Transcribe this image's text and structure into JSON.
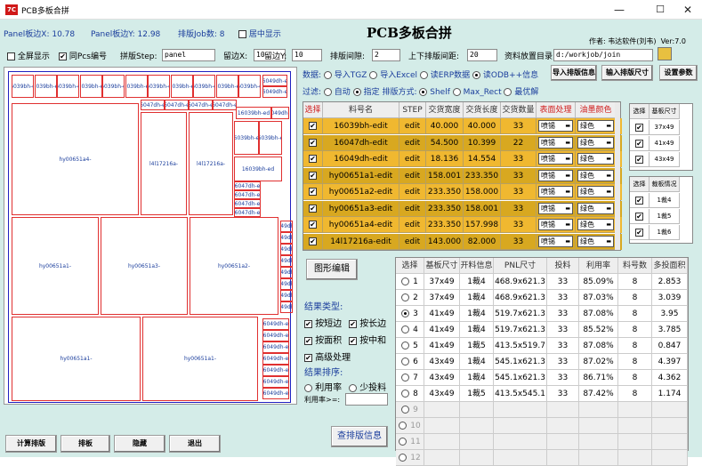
{
  "window": {
    "title": "PCB多板合拼",
    "minimize": "—",
    "maximize": "☐",
    "close": "✕"
  },
  "header": {
    "panel_x_label": "Panel板边X:",
    "panel_x": "10.78",
    "panel_y_label": "Panel板边Y:",
    "panel_y": "12.98",
    "jobs_label": "排版Job数:",
    "jobs": "8",
    "center_label": "居中显示",
    "app_title": "PCB多板合拼",
    "author": "作者: 韦达软件(刘韦)",
    "version": "Ver:7.0"
  },
  "opts": {
    "fullscreen": "全屏显示",
    "same_pcs": "同Pcs编号",
    "step_label": "拼版Step:",
    "step_value": "panel",
    "margin_x_label": "留边X:",
    "margin_x": "10",
    "margin_y_label": "留边Y:",
    "margin_y": "10",
    "gap_label": "排版间隙:",
    "gap": "2",
    "updown_label": "上下排版间距:",
    "updown": "20",
    "dir_label": "资料放置目录:",
    "dir": "d:/workjob/join"
  },
  "data_row": {
    "label": "数据:",
    "opt1": "导入TGZ",
    "opt2": "导入Excel",
    "opt3": "读ERP数据",
    "opt4": "读ODB++信息",
    "btn1": "导入排版信息",
    "btn2": "输入排版尺寸",
    "btn3": "设置参数"
  },
  "filter_row": {
    "label": "过滤:",
    "opt1": "自动",
    "opt2": "指定",
    "mode_label": "排版方式:",
    "mode1": "Shelf",
    "mode2": "Max_Rect",
    "mode3": "最优解"
  },
  "main_grid": {
    "headers": [
      "选择",
      "料号名",
      "STEP",
      "交货宽度",
      "交货长度",
      "交货数量",
      "表面处理",
      "油墨颜色"
    ],
    "rows": [
      {
        "sel": "✔",
        "name": "16039bh-edit",
        "step": "edit",
        "w": "40.000",
        "l": "40.000",
        "q": "33",
        "surface": "喷锡",
        "color": "绿色"
      },
      {
        "sel": "✔",
        "name": "16047dh-edit",
        "step": "edit",
        "w": "54.500",
        "l": "10.399",
        "q": "22",
        "surface": "喷锡",
        "color": "绿色"
      },
      {
        "sel": "✔",
        "name": "16049dh-edit",
        "step": "edit",
        "w": "18.136",
        "l": "14.554",
        "q": "33",
        "surface": "喷锡",
        "color": "绿色"
      },
      {
        "sel": "✔",
        "name": "hy00651a1-edit",
        "step": "edit",
        "w": "158.001",
        "l": "233.350",
        "q": "33",
        "surface": "喷锡",
        "color": "绿色"
      },
      {
        "sel": "✔",
        "name": "hy00651a2-edit",
        "step": "edit",
        "w": "233.350",
        "l": "158.000",
        "q": "33",
        "surface": "喷锡",
        "color": "绿色"
      },
      {
        "sel": "✔",
        "name": "hy00651a3-edit",
        "step": "edit",
        "w": "233.350",
        "l": "158.001",
        "q": "33",
        "surface": "喷锡",
        "color": "绿色"
      },
      {
        "sel": "✔",
        "name": "hy00651a4-edit",
        "step": "edit",
        "w": "233.350",
        "l": "157.998",
        "q": "33",
        "surface": "喷锡",
        "color": "绿色"
      },
      {
        "sel": "✔",
        "name": "14l17216a-edit",
        "step": "edit",
        "w": "143.000",
        "l": "82.000",
        "q": "33",
        "surface": "喷锡",
        "color": "绿色"
      }
    ]
  },
  "side_grid1": {
    "headers": [
      "选择",
      "基板尺寸"
    ],
    "rows": [
      {
        "sel": "✔",
        "v": "37x49"
      },
      {
        "sel": "✔",
        "v": "41x49"
      },
      {
        "sel": "✔",
        "v": "43x49"
      }
    ]
  },
  "side_grid2": {
    "headers": [
      "选择",
      "裁板情况"
    ],
    "rows": [
      {
        "sel": "✔",
        "v": "1裁4"
      },
      {
        "sel": "✔",
        "v": "1裁5"
      },
      {
        "sel": "✔",
        "v": "1裁6"
      }
    ]
  },
  "results": {
    "graph_btn": "图形编辑",
    "type_label": "结果类型:",
    "cb1": "按短边",
    "cb2": "按长边",
    "cb3": "按面积",
    "cb4": "按中和",
    "cb5": "高级处理",
    "sort_label": "结果排序:",
    "sort1": "利用率",
    "sort2": "少投料",
    "util_label": "利用率>=:",
    "query_btn": "查排版信息"
  },
  "result_grid": {
    "headers": [
      "选择",
      "基板尺寸",
      "开料信息",
      "PNL尺寸",
      "投料",
      "利用率",
      "料号数",
      "多投面积"
    ],
    "rows": [
      {
        "n": "1",
        "a": "37x49",
        "b": "1裁4",
        "c": "468.9x621.3",
        "d": "33",
        "e": "85.09%",
        "f": "8",
        "g": "2.853",
        "on": false
      },
      {
        "n": "2",
        "a": "37x49",
        "b": "1裁4",
        "c": "468.9x621.3",
        "d": "33",
        "e": "87.03%",
        "f": "8",
        "g": "3.039",
        "on": false
      },
      {
        "n": "3",
        "a": "41x49",
        "b": "1裁4",
        "c": "519.7x621.3",
        "d": "33",
        "e": "87.08%",
        "f": "8",
        "g": "3.95",
        "on": true
      },
      {
        "n": "4",
        "a": "41x49",
        "b": "1裁4",
        "c": "519.7x621.3",
        "d": "33",
        "e": "85.52%",
        "f": "8",
        "g": "3.785",
        "on": false
      },
      {
        "n": "5",
        "a": "41x49",
        "b": "1裁5",
        "c": "413.5x519.7",
        "d": "33",
        "e": "87.08%",
        "f": "8",
        "g": "0.847",
        "on": false
      },
      {
        "n": "6",
        "a": "43x49",
        "b": "1裁4",
        "c": "545.1x621.3",
        "d": "33",
        "e": "87.02%",
        "f": "8",
        "g": "4.397",
        "on": false
      },
      {
        "n": "7",
        "a": "43x49",
        "b": "1裁4",
        "c": "545.1x621.3",
        "d": "33",
        "e": "86.71%",
        "f": "8",
        "g": "4.362",
        "on": false
      },
      {
        "n": "8",
        "a": "43x49",
        "b": "1裁5",
        "c": "413.5x545.1",
        "d": "33",
        "e": "87.42%",
        "f": "8",
        "g": "1.174",
        "on": false
      }
    ],
    "empty_rows": [
      "9",
      "10",
      "11",
      "12"
    ]
  },
  "canvas": {
    "b16039": "16039bh-ed",
    "b16047": "16047dh-ed",
    "b16049": "16049dh-ed",
    "a4": "hy00651a4-",
    "a1": "hy00651a1-",
    "a3": "hy00651a3-",
    "a2": "hy00651a2-",
    "l14": "l4l17216a-"
  },
  "bottom": {
    "b1": "计算排版",
    "b2": "排板",
    "b3": "隐藏",
    "b4": "退出"
  },
  "colors": {
    "bg": "#d4ece8",
    "row": "#d8a820",
    "title_blue": "#1a3d9c",
    "board_border": "#e03030"
  }
}
